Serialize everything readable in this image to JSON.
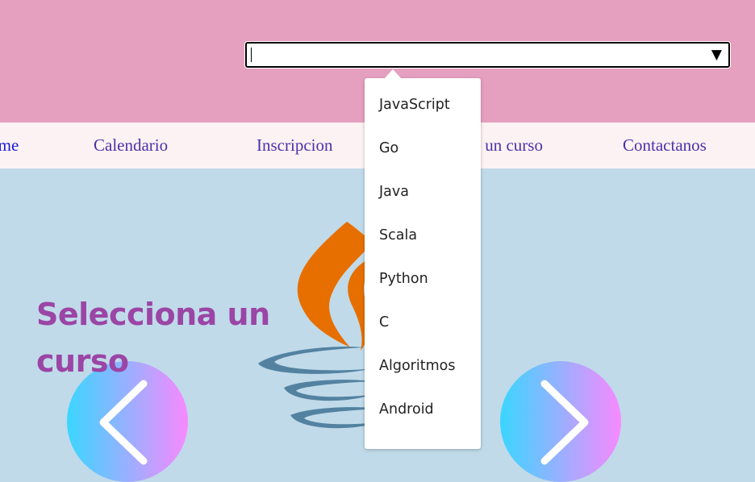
{
  "search": {
    "value": "",
    "dropdown_glyph": "▼"
  },
  "nav": {
    "items": [
      {
        "label": "Home"
      },
      {
        "label": "Calendario"
      },
      {
        "label": "Inscripcion"
      },
      {
        "label": "Selecciona un curso"
      },
      {
        "label": "Contactanos"
      }
    ]
  },
  "main": {
    "headline": "Selecciona un curso",
    "logo": "java-logo-icon",
    "prev_icon": "chevron-left-icon",
    "next_icon": "chevron-right-icon"
  },
  "datalist": {
    "options": [
      "JavaScript",
      "Go",
      "Java",
      "Scala",
      "Python",
      "C",
      "Algoritmos",
      "Android"
    ]
  },
  "colors": {
    "header_bg": "#e6a0bf",
    "nav_bg": "#fdf2f3",
    "nav_link": "#4f2fa8",
    "main_bg": "#c0dae9",
    "headline": "#9b45a5",
    "button_gradient_start": "#3ad6ff",
    "button_gradient_end": "#f889ff",
    "java_orange": "#e76f00",
    "java_blue": "#5382a1"
  }
}
